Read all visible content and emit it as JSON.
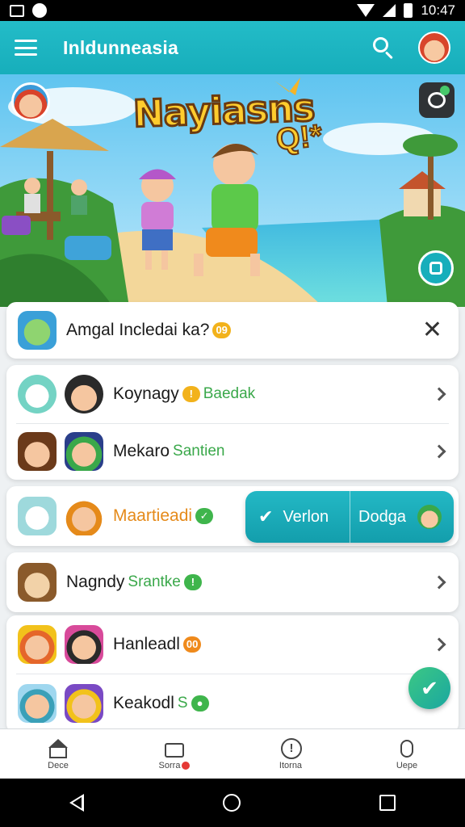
{
  "status_bar": {
    "time": "10:47"
  },
  "app_bar": {
    "title": "Inldunneasia"
  },
  "hero": {
    "title": "Nayiasns",
    "subtitle": "Q!*"
  },
  "notification": {
    "label": "Amgal Incledai ka?",
    "chip": "09",
    "close": "✕"
  },
  "group1": {
    "rows": [
      {
        "name": "Koynagy",
        "chip": "!",
        "tag": "Baedak"
      },
      {
        "name": "Mekaro",
        "tag": "Santien"
      }
    ]
  },
  "highlight_row": {
    "name": "Maartieadi",
    "chip": "✓"
  },
  "action": {
    "left_glyph": "✔",
    "left_label": "Verlon",
    "right_label": "Dodga"
  },
  "row4": {
    "name": "Nagndy",
    "tag": "Srantke",
    "chip": "!"
  },
  "group2": {
    "rows": [
      {
        "name": "Hanleadl",
        "chip": "00"
      },
      {
        "name": "Keakodl",
        "tag": "S",
        "chip": "●"
      }
    ]
  },
  "fab": {
    "glyph": "✔"
  },
  "bottom_nav": [
    {
      "label": "Dece",
      "icon": "home-icon"
    },
    {
      "label": "Sorra",
      "icon": "box-icon"
    },
    {
      "label": "Itorna",
      "icon": "info-icon"
    },
    {
      "label": "Uepe",
      "icon": "robot-icon"
    }
  ],
  "colors": {
    "accent": "#1bb3c0",
    "green": "#3aa84a",
    "orange": "#e58a1a"
  }
}
